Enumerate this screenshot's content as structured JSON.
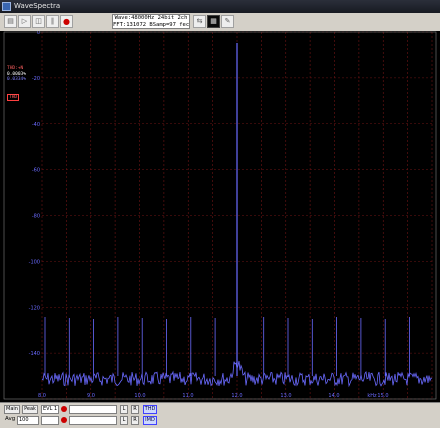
{
  "window": {
    "title": "WaveSpectra"
  },
  "toolbar": {
    "info_line1": "Wave:48000Hz 24bit 2ch",
    "info_line2": "FFT:131072 BSamp=97 fec"
  },
  "plot": {
    "y_labels": [
      "0",
      "-20",
      "-40",
      "-60",
      "-80",
      "-100",
      "-120",
      "-140"
    ],
    "x_labels": [
      "8.0",
      "9.0",
      "10.0",
      "11.0",
      "12.0",
      "13.0",
      "14.0",
      "kHz",
      "15.0"
    ],
    "legend": [
      "THD:+N",
      "0.0003%",
      "0.0334%",
      "THD"
    ],
    "colors": {
      "background": "#000000",
      "grid": "#6e1414",
      "trace": "#6a6aff",
      "axis": "#7d7d7d"
    }
  },
  "controls": {
    "row1": {
      "main_label": "Main",
      "peak_label": "Peak",
      "mode_value": "EVL 1",
      "l_label": "L",
      "r_label": "R",
      "stat_label": "THD"
    },
    "row2": {
      "avg_label": "Avg",
      "avg_value": "100",
      "l_label": "L",
      "r_label": "R",
      "stat_label": "IMD"
    }
  }
}
